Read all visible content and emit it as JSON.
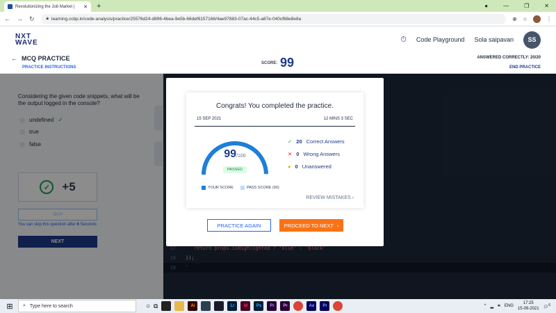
{
  "browser": {
    "tab_title": "Revolutionizing the Job Market |",
    "url": "learning.ccbp.in/code-analysis/practice/25576d24-d896-4bea-9e5b-66def6157166/4ae97883-07ac-44c5-a87e-040cf88e8e8a"
  },
  "header": {
    "logo_line1": "NXT",
    "logo_line2": "WAVE",
    "code_playground": "Code Playground",
    "user_name": "Sola saipavan",
    "avatar_initials": "SS"
  },
  "subheader": {
    "title": "MCQ PRACTICE",
    "instructions": "PRACTICE INSTRUCTIONS",
    "score_label": "SCORE:",
    "score_value": "99",
    "answered": "ANSWERED CORRECTLY: 20/20",
    "end_practice": "END PRACTICE"
  },
  "question": {
    "text": "Considering the given code snippets, what will be the output logged in the console?",
    "options": [
      "undefined",
      "true",
      "false"
    ],
    "points": "+5",
    "skip_label": "SKIP",
    "skip_note_prefix": "You can skip this question after ",
    "skip_seconds": "6",
    "skip_note_suffix": " Seconds",
    "next_label": "NEXT"
  },
  "code": {
    "lines": [
      {
        "n": "17",
        "text": "return props.isHighlighted ? 'blue' : 'black'"
      },
      {
        "n": "18",
        "text": "});"
      },
      {
        "n": "19",
        "text": "`"
      }
    ]
  },
  "modal": {
    "congrats": "Congrats! You completed the practice.",
    "date": "15 SEP 2021",
    "duration": "12 MINS 3 SEC",
    "score": "99",
    "out_of": "/100",
    "score_fraction": 0.99,
    "status": "PASSED",
    "correct_count": "20",
    "correct_label": "Correct Answers",
    "wrong_count": "0",
    "wrong_label": "Wrong Answers",
    "unanswered_count": "0",
    "unanswered_label": "Unanswered",
    "legend_your": "YOUR SCORE",
    "legend_pass": "PASS SCORE (90)",
    "review": "REVIEW MISTAKES",
    "practice_again": "PRACTICE AGAIN",
    "proceed": "PROCEED TO NEXT",
    "colors": {
      "accent": "#1d7fd8",
      "pass": "#bfdbfe",
      "orange": "#f97316"
    }
  },
  "taskbar": {
    "search_placeholder": "Type here to search",
    "lang": "ENG",
    "time": "17:25",
    "date": "15-09-2021",
    "notif_count": "6"
  }
}
